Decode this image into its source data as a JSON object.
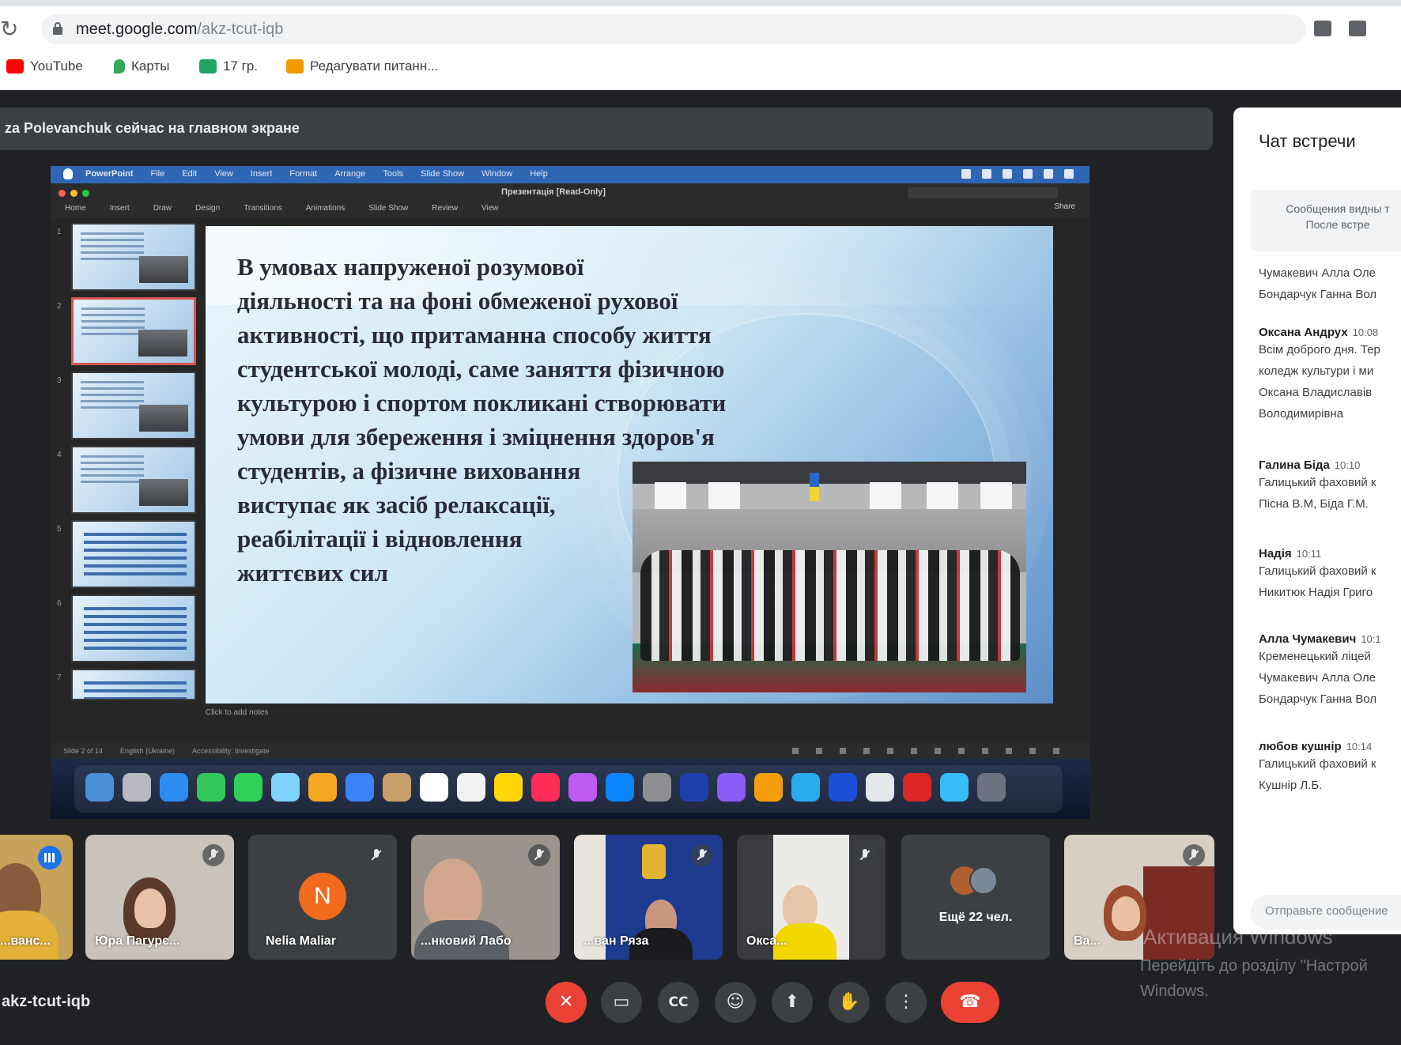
{
  "browser": {
    "url_host": "meet.google.com",
    "url_path": "/akz-tcut-iqb",
    "bookmarks": [
      {
        "label": "YouTube",
        "color": "#ff0000"
      },
      {
        "label": "Карты",
        "color": "#34a853"
      },
      {
        "label": "17 гр.",
        "color": "#1fa463"
      },
      {
        "label": "Редагувати питанн...",
        "color": "#f29900"
      }
    ]
  },
  "meet": {
    "presenting_banner": "za Polevanchuk сейчас на главном экране",
    "meeting_code": "akz-tcut-iqb"
  },
  "ppt": {
    "doc_title": "Презентація [Read-Only]",
    "ribbon_tabs": [
      "Home",
      "Insert",
      "Draw",
      "Design",
      "Transitions",
      "Animations",
      "Slide Show",
      "Review",
      "View"
    ],
    "share": "Share",
    "notes_placeholder": "Click to add notes",
    "status_items": [
      "Slide 2 of 14",
      "English (Ukraine)",
      "Accessibility: Investigate"
    ],
    "menu_items": [
      "PowerPoint",
      "File",
      "Edit",
      "View",
      "Insert",
      "Format",
      "Arrange",
      "Tools",
      "Slide Show",
      "Window",
      "Help"
    ],
    "thumbnails": [
      "1",
      "2",
      "3",
      "4",
      "5",
      "6",
      "7"
    ],
    "selected_slide": 2
  },
  "slide": {
    "lines": [
      "В умовах напруженої розумової",
      "діяльності та на фоні обмеженої рухової",
      "активності, що притаманна способу життя",
      "студентської молоді, саме заняття фізичною",
      "культурою і спортом покликані створювати",
      "умови для збереження і зміцнення здоров'я",
      "студентів, а фізичне виховання",
      "виступає як засіб релаксації,",
      "реабілітації і відновлення",
      "життєвих сил"
    ]
  },
  "participants": [
    {
      "name": "...ванс...",
      "type": "video",
      "speaking": true
    },
    {
      "name": "Юра Пагурє...",
      "type": "video"
    },
    {
      "name": "Nelia Maliar",
      "type": "avatar",
      "initial": "N"
    },
    {
      "name": "...нковий Лабо",
      "type": "video"
    },
    {
      "name": "...ван Ряза",
      "type": "video"
    },
    {
      "name": "Окса...",
      "type": "video"
    },
    {
      "name": "Ещё 22 чел.",
      "type": "more"
    },
    {
      "name": "Ва...",
      "type": "video"
    }
  ],
  "controls": [
    {
      "name": "mic-off-button",
      "glyph": "✕"
    },
    {
      "name": "camera-button",
      "glyph": "▭"
    },
    {
      "name": "captions-button",
      "glyph": "CC"
    },
    {
      "name": "emoji-button",
      "glyph": "☺"
    },
    {
      "name": "present-button",
      "glyph": "⬆"
    },
    {
      "name": "raise-hand-button",
      "glyph": "✋"
    },
    {
      "name": "more-options-button",
      "glyph": "⋮"
    },
    {
      "name": "leave-call-button",
      "glyph": "☎"
    }
  ],
  "chat": {
    "title": "Чат встречи",
    "notice_line1": "Сообщения видны т",
    "notice_line2": "После встре",
    "messages": [
      {
        "sender": "",
        "time": "",
        "lines": [
          "Чумакевич Алла Оле",
          "Бондарчук Ганна Вол"
        ]
      },
      {
        "sender": "Оксана Андрух",
        "time": "10:08",
        "lines": [
          "Всім доброго дня. Тер",
          "коледж культури і ми",
          "Оксана Владиславів",
          "Володимирівна"
        ]
      },
      {
        "sender": "Галина Біда",
        "time": "10:10",
        "lines": [
          "Галицький фаховий к",
          "Пісна В.М, Біда Г.М."
        ]
      },
      {
        "sender": "Надія",
        "time": "10:11",
        "lines": [
          "Галицький фаховий к",
          "Никитюк Надія Григо"
        ]
      },
      {
        "sender": "Алла Чумакевич",
        "time": "10:1",
        "lines": [
          "Кременецький ліцей",
          "Чумакевич Алла Оле",
          "Бондарчук Ганна Вол"
        ]
      },
      {
        "sender": "любов кушнір",
        "time": "10:14",
        "lines": [
          "Галицький фаховий к",
          "Кушнір Л.Б."
        ]
      }
    ],
    "input_placeholder": "Отправьте сообщение"
  },
  "watermark": {
    "title": "Активация Windows",
    "subtitle": "Перейдіть до розділу \"Настрой Windows."
  }
}
